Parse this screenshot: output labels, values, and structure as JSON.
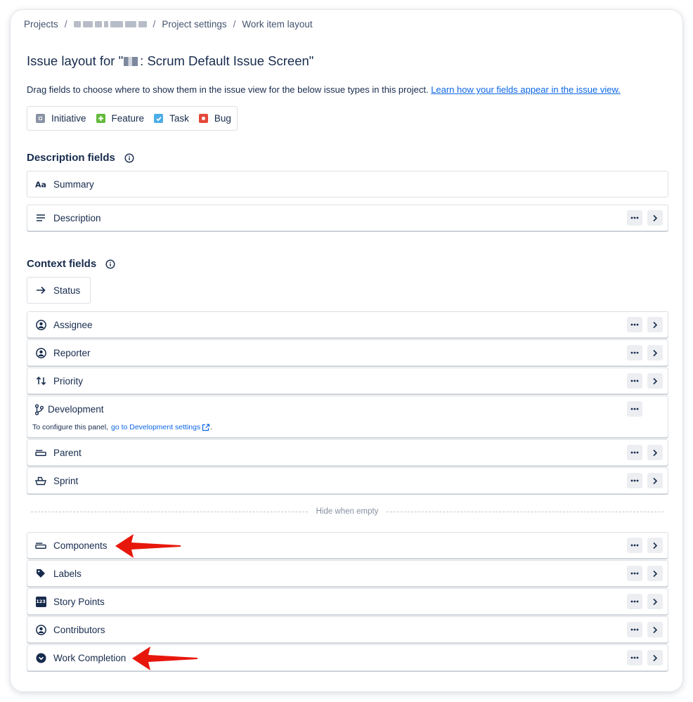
{
  "breadcrumb": {
    "projects": "Projects",
    "separator": "/",
    "project_settings": "Project settings",
    "current": "Work item layout"
  },
  "page": {
    "title_prefix": "Issue layout for \"",
    "title_suffix": ": Scrum Default Issue Screen\"",
    "description": "Drag fields to choose where to show them in the issue view for the below issue types in this project. ",
    "learn_link": "Learn how your fields appear in the issue view."
  },
  "issue_types": [
    {
      "label": "Initiative",
      "icon": "initiative-icon",
      "color": "#8993a4"
    },
    {
      "label": "Feature",
      "icon": "feature-icon",
      "color": "#63ba3c"
    },
    {
      "label": "Task",
      "icon": "task-icon",
      "color": "#4bade8"
    },
    {
      "label": "Bug",
      "icon": "bug-icon",
      "color": "#e5493a"
    }
  ],
  "description_section": {
    "heading": "Description fields",
    "fields": [
      {
        "label": "Summary",
        "icon": "text-format-icon"
      },
      {
        "label": "Description",
        "icon": "description-lines-icon"
      }
    ]
  },
  "context_section": {
    "heading": "Context fields",
    "status": {
      "label": "Status",
      "icon": "arrow-right-icon"
    },
    "fields": [
      {
        "label": "Assignee",
        "icon": "person-circle-icon"
      },
      {
        "label": "Reporter",
        "icon": "person-circle-icon"
      },
      {
        "label": "Priority",
        "icon": "priority-arrows-icon"
      },
      {
        "label": "Development",
        "icon": "branch-icon"
      },
      {
        "label": "Parent",
        "icon": "parent-icon"
      },
      {
        "label": "Sprint",
        "icon": "sprint-icon"
      }
    ],
    "development_note": {
      "text": "To configure this panel,",
      "link": "go to Development settings",
      "suffix": "."
    }
  },
  "hide_when_empty": {
    "label": "Hide when empty",
    "fields": [
      {
        "label": "Components",
        "icon": "component-icon"
      },
      {
        "label": "Labels",
        "icon": "tag-icon"
      },
      {
        "label": "Story Points",
        "icon": "number-icon",
        "icon_text": "123"
      },
      {
        "label": "Contributors",
        "icon": "person-circle-icon"
      },
      {
        "label": "Work Completion",
        "icon": "chevron-circle-icon"
      }
    ]
  },
  "colors": {
    "text": "#172b4d",
    "link": "#0c66e4",
    "annotation_arrow": "#e8170c"
  }
}
